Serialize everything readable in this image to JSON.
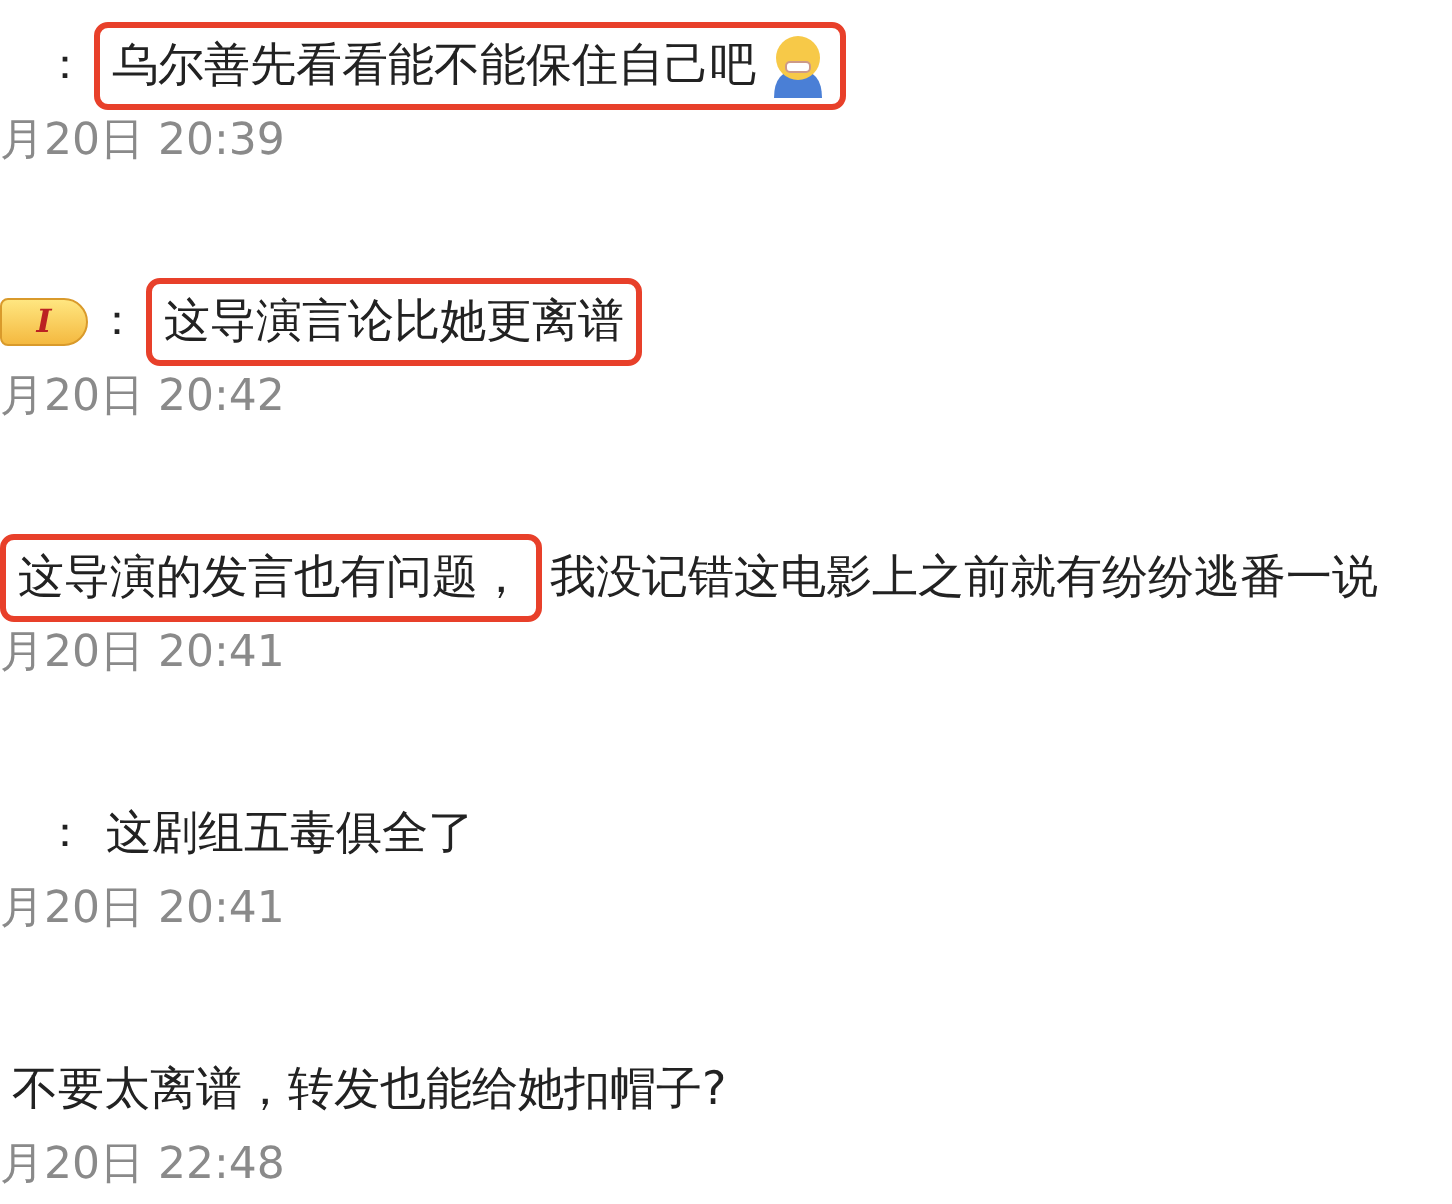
{
  "comments": [
    {
      "separator": "：",
      "emoji": true,
      "segments": [
        {
          "text": "乌尔善先看看能不能保住自己吧",
          "highlight": true
        }
      ],
      "time": "月20日 20:39"
    },
    {
      "badge": "I",
      "separator": "：",
      "segments": [
        {
          "text": "这导演言论比她更离谱",
          "highlight": true
        }
      ],
      "time": "月20日 20:42"
    },
    {
      "segments": [
        {
          "text": "这导演的发言也有问题，",
          "highlight": true
        },
        {
          "text": "我没记错这电影上之前就有纷纷逃番一说",
          "highlight": false
        }
      ],
      "time": "月20日 20:41"
    },
    {
      "separator": "：",
      "segments": [
        {
          "text": "这剧组五毒俱全了",
          "highlight": false
        }
      ],
      "time": "月20日 20:41"
    },
    {
      "segments": [
        {
          "text": "不要太离谱，转发也能给她扣帽子?",
          "highlight": false
        }
      ],
      "time": "月20日 22:48"
    }
  ]
}
